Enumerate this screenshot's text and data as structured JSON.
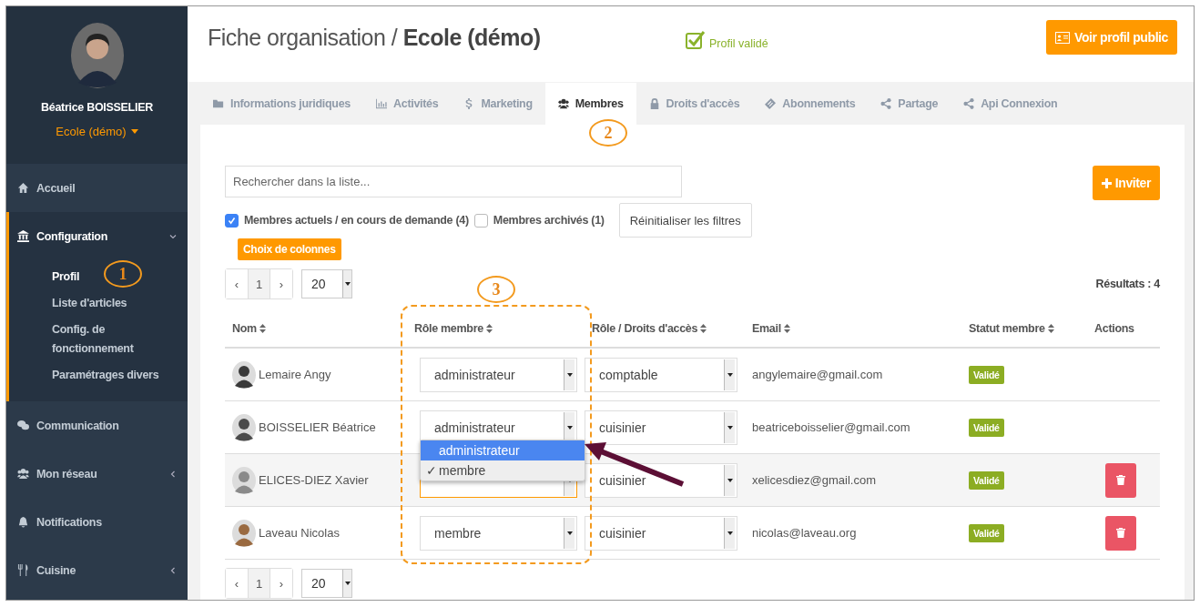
{
  "sidebar": {
    "user_name": "Béatrice BOISSELIER",
    "organization": "Ecole (démo)",
    "menu": [
      {
        "label": "Accueil"
      },
      {
        "label": "Configuration",
        "expanded": true,
        "children": [
          {
            "label": "Profil",
            "selected": true
          },
          {
            "label": "Liste d'articles",
            "selected": false
          },
          {
            "label": "Config. de fonctionnement",
            "selected": false
          },
          {
            "label": "Paramétrages divers",
            "selected": false
          }
        ]
      },
      {
        "label": "Communication"
      },
      {
        "label": "Mon réseau",
        "expanded": false
      },
      {
        "label": "Notifications"
      },
      {
        "label": "Cuisine",
        "expanded": false
      }
    ]
  },
  "header": {
    "title": "Fiche organisation / **Ecole (démo)**",
    "status": "Profil validé",
    "public_button": "Voir profil public"
  },
  "tabs": [
    {
      "label": "Informations juridiques",
      "selected": false
    },
    {
      "label": "Activités",
      "selected": false
    },
    {
      "label": "Marketing",
      "selected": false
    },
    {
      "label": "Membres",
      "selected": true
    },
    {
      "label": "Droits d'accès",
      "selected": false
    },
    {
      "label": "Abonnements",
      "selected": false
    },
    {
      "label": "Partage",
      "selected": false
    },
    {
      "label": "Api Connexion",
      "selected": false
    }
  ],
  "search": {
    "placeholder": "Rechercher dans la liste..."
  },
  "invite_button": "Inviter",
  "filters": [
    {
      "label": "Membres actuels / en cours de demande (4)",
      "checked": true
    },
    {
      "label": "Membres archivés (1)",
      "checked": false
    }
  ],
  "reset_button": "Réinitialiser les filtres",
  "columns_button": "Choix de colonnes",
  "pagination_top": {
    "prev": "‹",
    "page": "1",
    "next": "›",
    "page_size": "20"
  },
  "results": "Résultats : 4",
  "table": {
    "columns": [
      "Nom",
      "Rôle membre",
      "Rôle / Droits d'accès",
      "Email",
      "Statut membre",
      "Actions"
    ],
    "rows": [
      {
        "name": "Lemaire Angy",
        "role": "administrateur",
        "access": "comptable",
        "email": "angylemaire@gmail.com",
        "status": "Validé",
        "focused": false,
        "deletable": false
      },
      {
        "name": "BOISSELIER Béatrice",
        "role": "administrateur",
        "access": "cuisinier",
        "email": "beatriceboisselier@gmail.com",
        "status": "Validé",
        "focused": false,
        "deletable": false
      },
      {
        "name": "ELICES-DIEZ Xavier",
        "access": "cuisinier",
        "email": "xelicesdiez@gmail.com",
        "status": "Validé",
        "focused": true,
        "deletable": true
      },
      {
        "name": "Laveau Nicolas",
        "role": "membre",
        "access": "cuisinier",
        "email": "nicolas@laveau.org",
        "status": "Validé",
        "focused": false,
        "deletable": true
      }
    ]
  },
  "dropdown": {
    "options": [
      {
        "label": "administrateur",
        "selected": true,
        "checked": false
      },
      {
        "label": "membre",
        "selected": false,
        "checked": true
      }
    ],
    "check_mark": "✓"
  },
  "pagination_bottom": {
    "prev": "‹",
    "page": "1",
    "next": "›",
    "page_size": "20"
  },
  "annotations": [
    "1",
    "2",
    "3"
  ]
}
